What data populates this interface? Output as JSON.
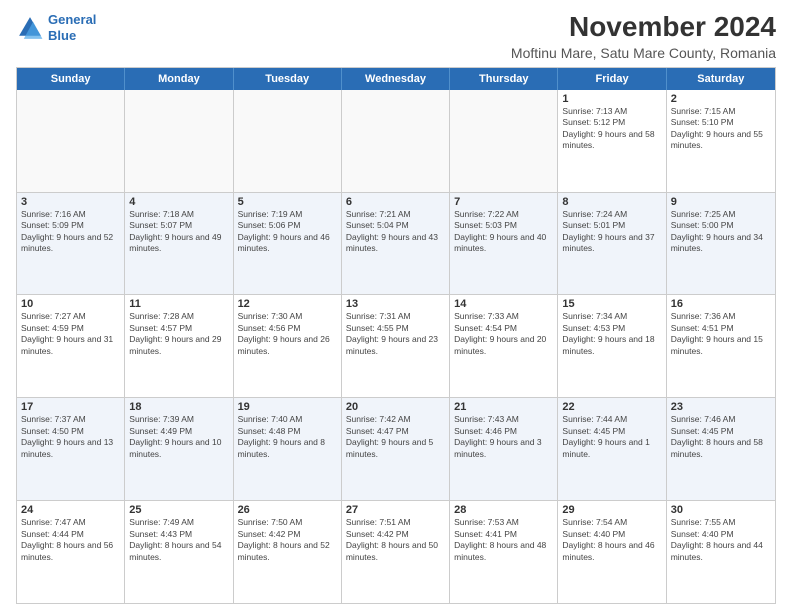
{
  "logo": {
    "line1": "General",
    "line2": "Blue"
  },
  "title": "November 2024",
  "subtitle": "Moftinu Mare, Satu Mare County, Romania",
  "header_days": [
    "Sunday",
    "Monday",
    "Tuesday",
    "Wednesday",
    "Thursday",
    "Friday",
    "Saturday"
  ],
  "weeks": [
    [
      {
        "day": "",
        "info": ""
      },
      {
        "day": "",
        "info": ""
      },
      {
        "day": "",
        "info": ""
      },
      {
        "day": "",
        "info": ""
      },
      {
        "day": "",
        "info": ""
      },
      {
        "day": "1",
        "info": "Sunrise: 7:13 AM\nSunset: 5:12 PM\nDaylight: 9 hours and 58 minutes."
      },
      {
        "day": "2",
        "info": "Sunrise: 7:15 AM\nSunset: 5:10 PM\nDaylight: 9 hours and 55 minutes."
      }
    ],
    [
      {
        "day": "3",
        "info": "Sunrise: 7:16 AM\nSunset: 5:09 PM\nDaylight: 9 hours and 52 minutes."
      },
      {
        "day": "4",
        "info": "Sunrise: 7:18 AM\nSunset: 5:07 PM\nDaylight: 9 hours and 49 minutes."
      },
      {
        "day": "5",
        "info": "Sunrise: 7:19 AM\nSunset: 5:06 PM\nDaylight: 9 hours and 46 minutes."
      },
      {
        "day": "6",
        "info": "Sunrise: 7:21 AM\nSunset: 5:04 PM\nDaylight: 9 hours and 43 minutes."
      },
      {
        "day": "7",
        "info": "Sunrise: 7:22 AM\nSunset: 5:03 PM\nDaylight: 9 hours and 40 minutes."
      },
      {
        "day": "8",
        "info": "Sunrise: 7:24 AM\nSunset: 5:01 PM\nDaylight: 9 hours and 37 minutes."
      },
      {
        "day": "9",
        "info": "Sunrise: 7:25 AM\nSunset: 5:00 PM\nDaylight: 9 hours and 34 minutes."
      }
    ],
    [
      {
        "day": "10",
        "info": "Sunrise: 7:27 AM\nSunset: 4:59 PM\nDaylight: 9 hours and 31 minutes."
      },
      {
        "day": "11",
        "info": "Sunrise: 7:28 AM\nSunset: 4:57 PM\nDaylight: 9 hours and 29 minutes."
      },
      {
        "day": "12",
        "info": "Sunrise: 7:30 AM\nSunset: 4:56 PM\nDaylight: 9 hours and 26 minutes."
      },
      {
        "day": "13",
        "info": "Sunrise: 7:31 AM\nSunset: 4:55 PM\nDaylight: 9 hours and 23 minutes."
      },
      {
        "day": "14",
        "info": "Sunrise: 7:33 AM\nSunset: 4:54 PM\nDaylight: 9 hours and 20 minutes."
      },
      {
        "day": "15",
        "info": "Sunrise: 7:34 AM\nSunset: 4:53 PM\nDaylight: 9 hours and 18 minutes."
      },
      {
        "day": "16",
        "info": "Sunrise: 7:36 AM\nSunset: 4:51 PM\nDaylight: 9 hours and 15 minutes."
      }
    ],
    [
      {
        "day": "17",
        "info": "Sunrise: 7:37 AM\nSunset: 4:50 PM\nDaylight: 9 hours and 13 minutes."
      },
      {
        "day": "18",
        "info": "Sunrise: 7:39 AM\nSunset: 4:49 PM\nDaylight: 9 hours and 10 minutes."
      },
      {
        "day": "19",
        "info": "Sunrise: 7:40 AM\nSunset: 4:48 PM\nDaylight: 9 hours and 8 minutes."
      },
      {
        "day": "20",
        "info": "Sunrise: 7:42 AM\nSunset: 4:47 PM\nDaylight: 9 hours and 5 minutes."
      },
      {
        "day": "21",
        "info": "Sunrise: 7:43 AM\nSunset: 4:46 PM\nDaylight: 9 hours and 3 minutes."
      },
      {
        "day": "22",
        "info": "Sunrise: 7:44 AM\nSunset: 4:45 PM\nDaylight: 9 hours and 1 minute."
      },
      {
        "day": "23",
        "info": "Sunrise: 7:46 AM\nSunset: 4:45 PM\nDaylight: 8 hours and 58 minutes."
      }
    ],
    [
      {
        "day": "24",
        "info": "Sunrise: 7:47 AM\nSunset: 4:44 PM\nDaylight: 8 hours and 56 minutes."
      },
      {
        "day": "25",
        "info": "Sunrise: 7:49 AM\nSunset: 4:43 PM\nDaylight: 8 hours and 54 minutes."
      },
      {
        "day": "26",
        "info": "Sunrise: 7:50 AM\nSunset: 4:42 PM\nDaylight: 8 hours and 52 minutes."
      },
      {
        "day": "27",
        "info": "Sunrise: 7:51 AM\nSunset: 4:42 PM\nDaylight: 8 hours and 50 minutes."
      },
      {
        "day": "28",
        "info": "Sunrise: 7:53 AM\nSunset: 4:41 PM\nDaylight: 8 hours and 48 minutes."
      },
      {
        "day": "29",
        "info": "Sunrise: 7:54 AM\nSunset: 4:40 PM\nDaylight: 8 hours and 46 minutes."
      },
      {
        "day": "30",
        "info": "Sunrise: 7:55 AM\nSunset: 4:40 PM\nDaylight: 8 hours and 44 minutes."
      }
    ]
  ]
}
